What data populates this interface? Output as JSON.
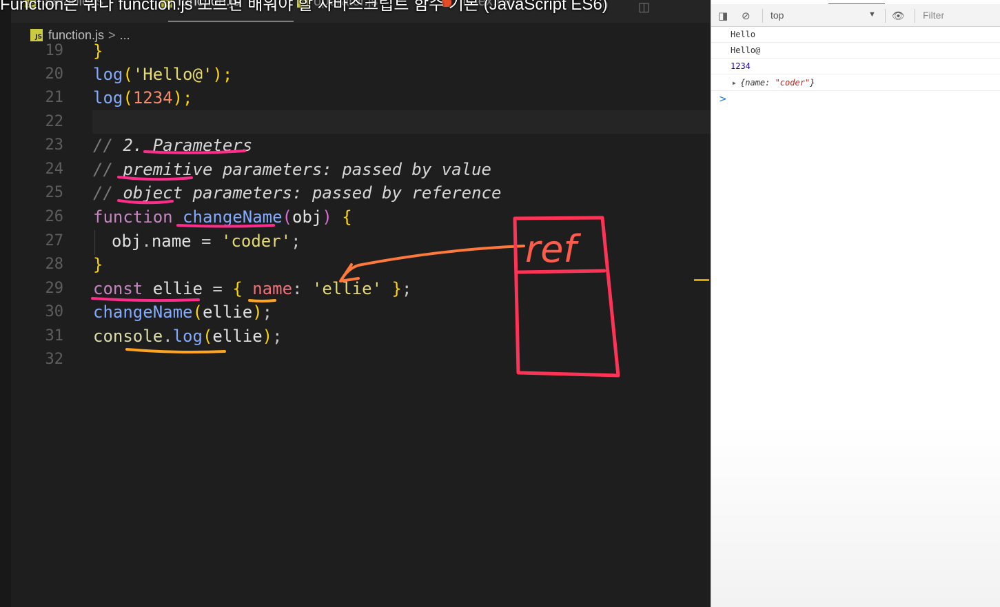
{
  "caption": "Function은 뭐다 function.js 모르면 배워야 할 자바스크립트 함수 기본 (JavaScript ES6)",
  "tabs": [
    {
      "label": "variable.js",
      "active": false
    },
    {
      "label": "function.js",
      "active": true
    },
    {
      "label": "operator.js",
      "active": false
    },
    {
      "label": "index.html",
      "active": false
    }
  ],
  "breadcrumb": {
    "file": "function.js",
    "separator": ">",
    "more": "..."
  },
  "badge_text": "JS",
  "gutter": [
    "19",
    "20",
    "21",
    "22",
    "23",
    "24",
    "25",
    "26",
    "27",
    "28",
    "29",
    "30",
    "31",
    "32"
  ],
  "code": {
    "l19": "}",
    "l20": {
      "fn": "log",
      "p1": "(",
      "str": "'Hello@'",
      "p2": ");"
    },
    "l21": {
      "fn": "log",
      "p1": "(",
      "num": "1234",
      "p2": ");"
    },
    "l23": {
      "c": "// ",
      "t": "2. Parameters"
    },
    "l24": {
      "c": "// ",
      "t": "premitive parameters: passed by value"
    },
    "l25": {
      "c": "// ",
      "t": "object parameters: passed by reference"
    },
    "l26": {
      "kw": "function",
      "name": "changeName",
      "p1": "(",
      "arg": "obj",
      "p2": ")",
      "b": "{"
    },
    "l27": {
      "obj": "obj",
      "dot": ".",
      "prop": "name",
      "eq": " = ",
      "str": "'coder'",
      "end": ";"
    },
    "l28": "}",
    "l29": {
      "kw": "const",
      "v": "ellie",
      "eq": " = ",
      "b1": "{",
      "key": "name",
      "colon": ":",
      "str": "'ellie'",
      "b2": "}",
      "end": ";"
    },
    "l30": {
      "fn": "changeName",
      "p1": "(",
      "arg": "ellie",
      "p2": ")",
      "end": ";"
    },
    "l31": {
      "obj": "console",
      "dot": ".",
      "fn": "log",
      "p1": "(",
      "arg": "ellie",
      "p2": ")",
      "end": ";"
    }
  },
  "annotation": {
    "text": "ref"
  },
  "devtools": {
    "context": "top",
    "filter_placeholder": "Filter",
    "logs": [
      {
        "text": "Hello",
        "color": "#333333"
      },
      {
        "text": "Hello@",
        "color": "#333333"
      },
      {
        "text": "1234",
        "color": "#1c00cf"
      }
    ],
    "object_log": {
      "open": "{name: ",
      "value": "\"coder\"",
      "close": "}"
    },
    "prompt": ">"
  },
  "colors": {
    "highlight_pink": "#ff2d8a",
    "highlight_orange": "#ffa51f",
    "box_red": "#ff3355",
    "arrow": "#ff7a3a"
  }
}
